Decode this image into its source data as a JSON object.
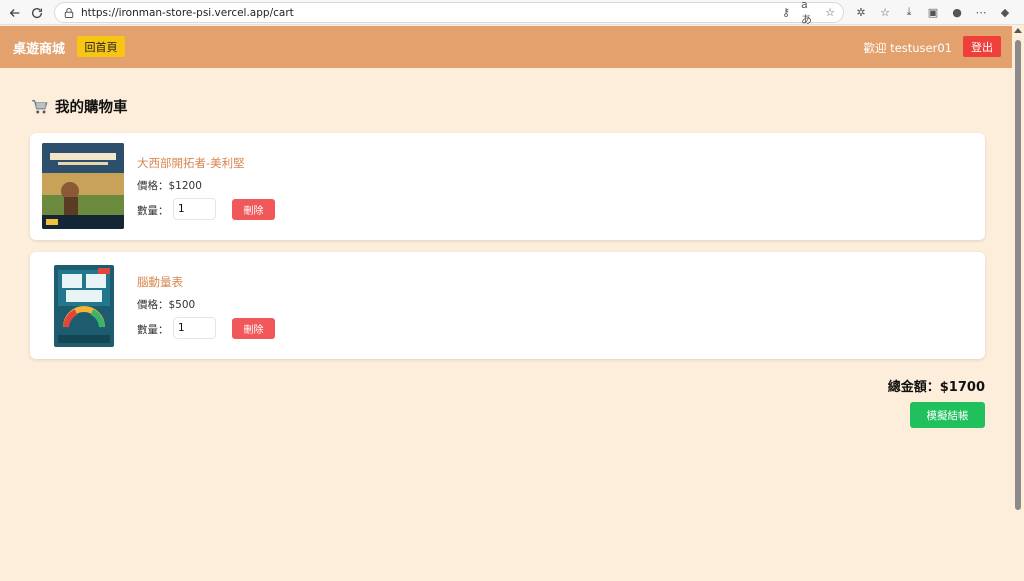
{
  "browser": {
    "url": "https://ironman-store-psi.vercel.app/cart"
  },
  "header": {
    "brand": "桌遊商城",
    "home_label": "回首頁",
    "welcome": "歡迎 testuser01",
    "logout_label": "登出"
  },
  "page": {
    "title": "我的購物車"
  },
  "cart": {
    "items": [
      {
        "name": "大西部開拓者-美利堅",
        "price": "價格：$1200",
        "qty_label": "數量：",
        "qty": "1",
        "delete_label": "刪除"
      },
      {
        "name": "腦動量表",
        "price": "價格：$500",
        "qty_label": "數量：",
        "qty": "1",
        "delete_label": "刪除"
      }
    ],
    "total": "總金額：$1700",
    "checkout_label": "模擬結帳"
  },
  "colors": {
    "header_bg": "#e2a16d",
    "page_bg": "#fdeedb",
    "home_button": "#f7c514",
    "logout_button": "#ee3f3a",
    "delete_button": "#f0585a",
    "checkout_button": "#20c05c",
    "item_name": "#d8864e"
  }
}
